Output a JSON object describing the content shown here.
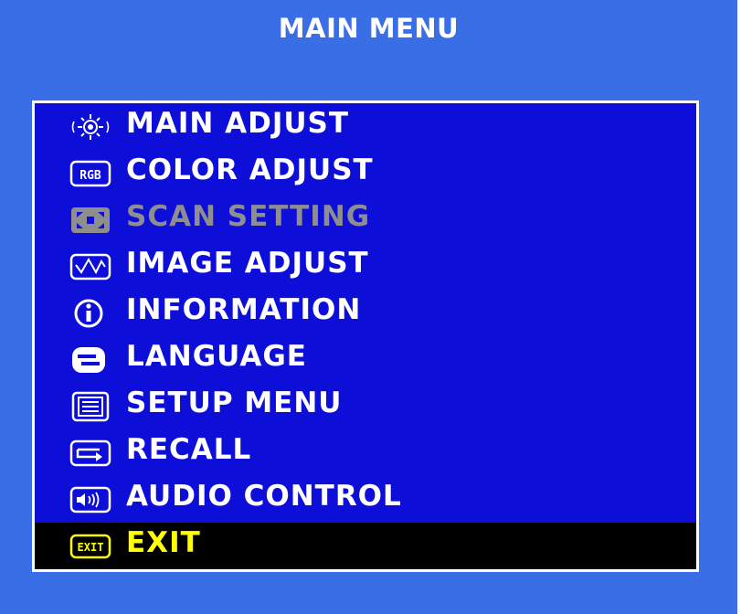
{
  "menu": {
    "title": "MAIN MENU",
    "items": [
      {
        "label": "MAIN ADJUST",
        "icon": "main-adjust-icon",
        "state": "normal"
      },
      {
        "label": "COLOR ADJUST",
        "icon": "rgb-icon",
        "icon_text": "RGB",
        "state": "normal"
      },
      {
        "label": "SCAN SETTING",
        "icon": "scan-setting-icon",
        "state": "disabled"
      },
      {
        "label": "IMAGE ADJUST",
        "icon": "waveform-icon",
        "state": "normal"
      },
      {
        "label": "INFORMATION",
        "icon": "info-icon",
        "state": "normal"
      },
      {
        "label": "LANGUAGE",
        "icon": "language-icon",
        "state": "normal"
      },
      {
        "label": "SETUP MENU",
        "icon": "setup-menu-icon",
        "state": "normal"
      },
      {
        "label": "RECALL",
        "icon": "recall-icon",
        "state": "normal"
      },
      {
        "label": "AUDIO CONTROL",
        "icon": "audio-icon",
        "state": "normal"
      },
      {
        "label": "EXIT",
        "icon": "exit-icon",
        "icon_text": "EXIT",
        "state": "selected"
      }
    ]
  },
  "colors": {
    "background": "#3a6ee6",
    "panel": "#0d0ed8",
    "text": "#ffffff",
    "disabled_text": "#8e8e8e",
    "selected_background": "#000000",
    "selected_text": "#ffff00"
  }
}
